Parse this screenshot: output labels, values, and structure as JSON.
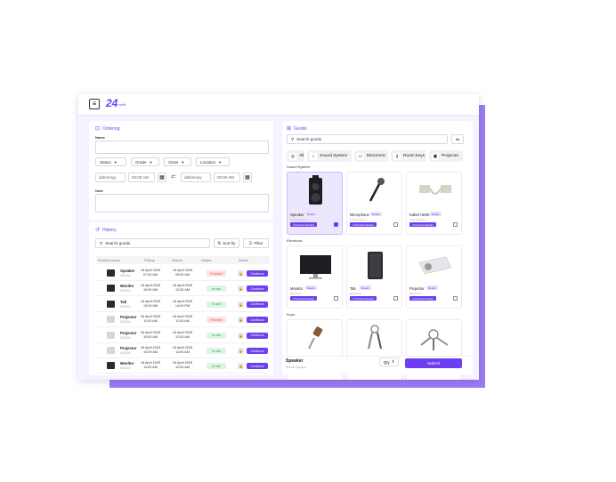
{
  "brand": {
    "logo_number": "24",
    "logo_text": "cells"
  },
  "ordering": {
    "title": "Ordering",
    "name_label": "Name",
    "filters": [
      "Status",
      "Grade",
      "Class",
      "Location"
    ],
    "date_placeholder": "dd/mm/yy",
    "start_time": "00:00 AM",
    "end_time": "00:00 AM",
    "note_label": "Note"
  },
  "history": {
    "title": "History",
    "search_placeholder": "Search goods",
    "sort_label": "Sort by",
    "filter_label": "Filter",
    "columns": [
      "Product name",
      "Pickup",
      "Return",
      "Status",
      "Action"
    ],
    "rows": [
      {
        "name": "Speaker",
        "id": "#82001",
        "pickup_date": "16 April 2025",
        "pickup_time": "07:00 AM",
        "return_date": "16 April 2025",
        "return_time": "09:00 AM",
        "status": "Finished",
        "action": "Continue",
        "thumb": "dark"
      },
      {
        "name": "Monitor",
        "id": "#82002",
        "pickup_date": "16 April 2025",
        "pickup_time": "10:00 AM",
        "return_date": "16 April 2025",
        "return_time": "12:00 AM",
        "status": "In use",
        "action": "Continue",
        "thumb": "dark"
      },
      {
        "name": "Tab",
        "id": "#82003",
        "pickup_date": "16 April 2025",
        "pickup_time": "13:00 AM",
        "return_date": "16 April 2025",
        "return_time": "14:00 PM",
        "status": "In use",
        "action": "Continue",
        "thumb": "dark"
      },
      {
        "name": "Projector",
        "id": "#82004",
        "pickup_date": "16 April 2025",
        "pickup_time": "11:00 AM",
        "return_date": "16 April 2025",
        "return_time": "11:00 AM",
        "status": "Finished",
        "action": "Continue",
        "thumb": "light"
      },
      {
        "name": "Projector",
        "id": "#82005",
        "pickup_date": "16 April 2025",
        "pickup_time": "10:00 AM",
        "return_date": "16 April 2025",
        "return_time": "12:00 AM",
        "status": "In use",
        "action": "Continue",
        "thumb": "light"
      },
      {
        "name": "Projector",
        "id": "#82006",
        "pickup_date": "16 April 2025",
        "pickup_time": "10:09 AM",
        "return_date": "16 April 2025",
        "return_time": "11:00 AM",
        "status": "In use",
        "action": "Continue",
        "thumb": "light"
      },
      {
        "name": "Monitor",
        "id": "#82007",
        "pickup_date": "16 April 2025",
        "pickup_time": "11:00 AM",
        "return_date": "16 April 2025",
        "return_time": "12:00 AM",
        "status": "In use",
        "action": "Continue",
        "thumb": "dark"
      }
    ]
  },
  "goods": {
    "title": "Goods",
    "search_placeholder": "Search goods",
    "categories": [
      "All",
      "Sound System",
      "Electronic",
      "Room keys",
      "Projector"
    ],
    "sections": [
      {
        "title": "Sound System",
        "items": [
          {
            "name": "Speaker",
            "tag": "Ready",
            "sub": "Sound System",
            "ready": "4 Products Ready",
            "checked": true,
            "selected": true
          },
          {
            "name": "Microphone",
            "tag": "Ready",
            "sub": "Sound System",
            "ready": "2 Products Ready",
            "checked": false,
            "selected": false
          },
          {
            "name": "Kabel HDMI",
            "tag": "Ready",
            "sub": "Sound System",
            "ready": "4 Products Ready",
            "checked": false,
            "selected": false
          }
        ]
      },
      {
        "title": "Electronic",
        "items": [
          {
            "name": "Monitor",
            "tag": "Ready",
            "sub": "Electronic",
            "ready": "3 Products Ready",
            "checked": false,
            "selected": false
          },
          {
            "name": "Tab",
            "tag": "Ready",
            "sub": "Electronic",
            "ready": "1 Products Ready",
            "checked": false,
            "selected": false
          },
          {
            "name": "Projector",
            "tag": "Ready",
            "sub": "Electronic",
            "ready": "2 Products Ready",
            "checked": false,
            "selected": false
          }
        ]
      },
      {
        "title": "Keys",
        "items": [
          {
            "name": "",
            "tag": "",
            "sub": "",
            "ready": "",
            "checked": false,
            "selected": false
          },
          {
            "name": "",
            "tag": "",
            "sub": "",
            "ready": "",
            "checked": false,
            "selected": false
          },
          {
            "name": "",
            "tag": "",
            "sub": "",
            "ready": "",
            "checked": false,
            "selected": false
          }
        ]
      }
    ],
    "footer": {
      "selected_name": "Speaker",
      "selected_sub": "Sound System",
      "qty_label": "Qty",
      "submit_label": "Submit"
    }
  },
  "colors": {
    "accent": "#6d3ff0",
    "backdrop": "#9b7cf0",
    "app_bg": "#f6f2ff"
  }
}
